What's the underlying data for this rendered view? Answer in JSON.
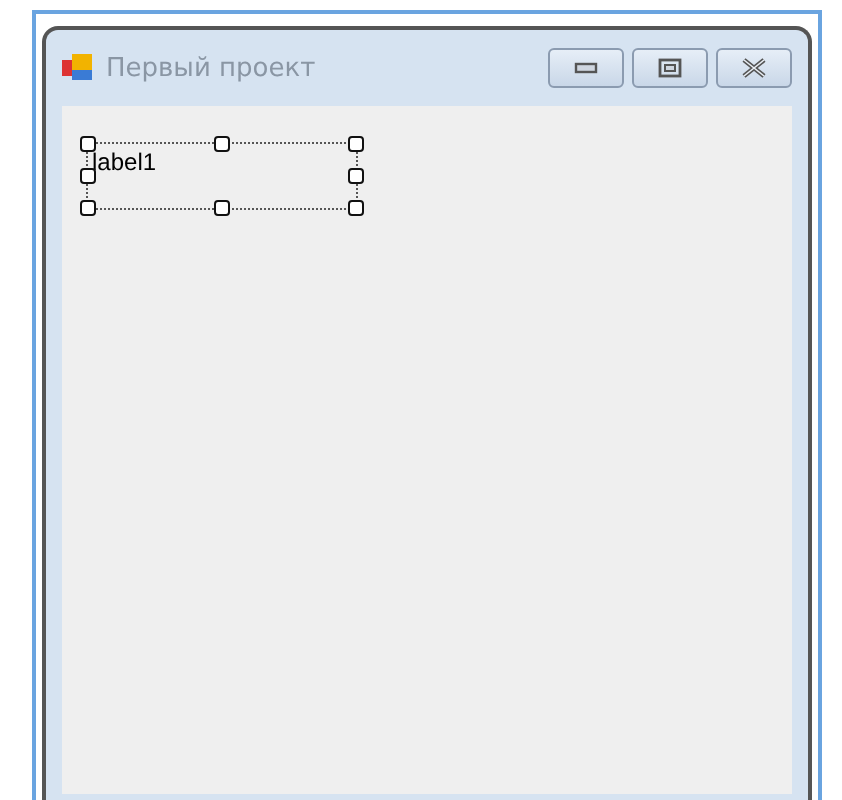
{
  "window": {
    "title": "Первый проект"
  },
  "form": {
    "label": {
      "text": "label1",
      "selected": true
    }
  }
}
